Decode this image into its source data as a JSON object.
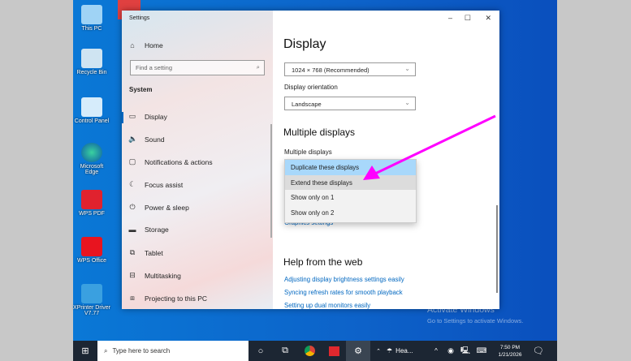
{
  "desktop": {
    "icons": [
      "This PC",
      "Recycle Bin",
      "Control Panel",
      "Microsoft Edge",
      "WPS PDF",
      "WPS Office",
      "XPrinter Driver V7.77"
    ],
    "watermark_title": "Activate Windows",
    "watermark_sub": "Go to Settings to activate Windows."
  },
  "window": {
    "title": "Settings",
    "minimize": "–",
    "maximize": "☐",
    "close": "✕"
  },
  "sidebar": {
    "home": "Home",
    "search_placeholder": "Find a setting",
    "section": "System",
    "items": [
      {
        "label": "Display",
        "icon": "▭"
      },
      {
        "label": "Sound",
        "icon": "🔈"
      },
      {
        "label": "Notifications & actions",
        "icon": "▢"
      },
      {
        "label": "Focus assist",
        "icon": "☾"
      },
      {
        "label": "Power & sleep",
        "icon": "⏻"
      },
      {
        "label": "Storage",
        "icon": "▬"
      },
      {
        "label": "Tablet",
        "icon": "⧉"
      },
      {
        "label": "Multitasking",
        "icon": "⊟"
      },
      {
        "label": "Projecting to this PC",
        "icon": "⧈"
      }
    ]
  },
  "content": {
    "title": "Display",
    "resolution": "1024 × 768 (Recommended)",
    "orientation_label": "Display orientation",
    "orientation": "Landscape",
    "multi_heading": "Multiple displays",
    "multi_label": "Multiple displays",
    "options": [
      "Duplicate these displays",
      "Extend these displays",
      "Show only on 1",
      "Show only on 2"
    ],
    "graphics_link": "Graphics settings",
    "help_heading": "Help from the web",
    "help_links": [
      "Adjusting display brightness settings easily",
      "Syncing refresh rates for smooth playback",
      "Setting up dual monitors easily"
    ]
  },
  "taskbar": {
    "search_placeholder": "Type here to search",
    "weather": "Hea...",
    "time": "7:50 PM",
    "date": "1/21/2026"
  },
  "colors": {
    "arrow": "#ff00ff",
    "accent": "#0067c0",
    "highlight": "#a8d8fb"
  }
}
